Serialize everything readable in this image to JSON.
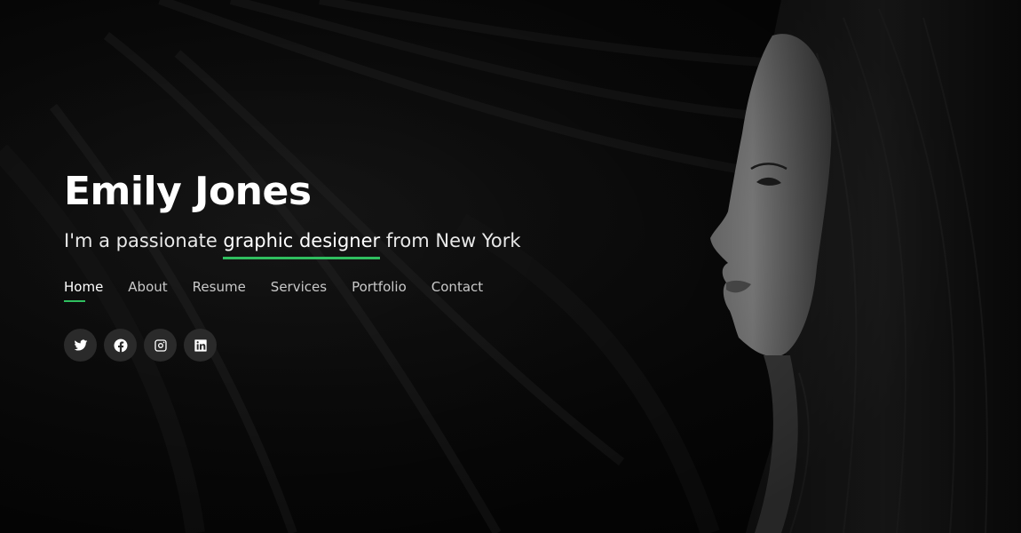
{
  "hero": {
    "name": "Emily Jones",
    "tagline_prefix": "I'm a passionate ",
    "tagline_highlight": "graphic designer",
    "tagline_suffix": " from New York"
  },
  "nav": {
    "items": [
      {
        "label": "Home",
        "active": true
      },
      {
        "label": "About",
        "active": false
      },
      {
        "label": "Resume",
        "active": false
      },
      {
        "label": "Services",
        "active": false
      },
      {
        "label": "Portfolio",
        "active": false
      },
      {
        "label": "Contact",
        "active": false
      }
    ]
  },
  "social": [
    {
      "icon": "twitter-icon"
    },
    {
      "icon": "facebook-icon"
    },
    {
      "icon": "instagram-icon"
    },
    {
      "icon": "linkedin-icon"
    }
  ],
  "colors": {
    "accent": "#2fbf5f",
    "background": "#0a0a0a",
    "text": "#ffffff",
    "muted_text": "#c9c9c9",
    "social_bg": "#2a2a2a"
  }
}
